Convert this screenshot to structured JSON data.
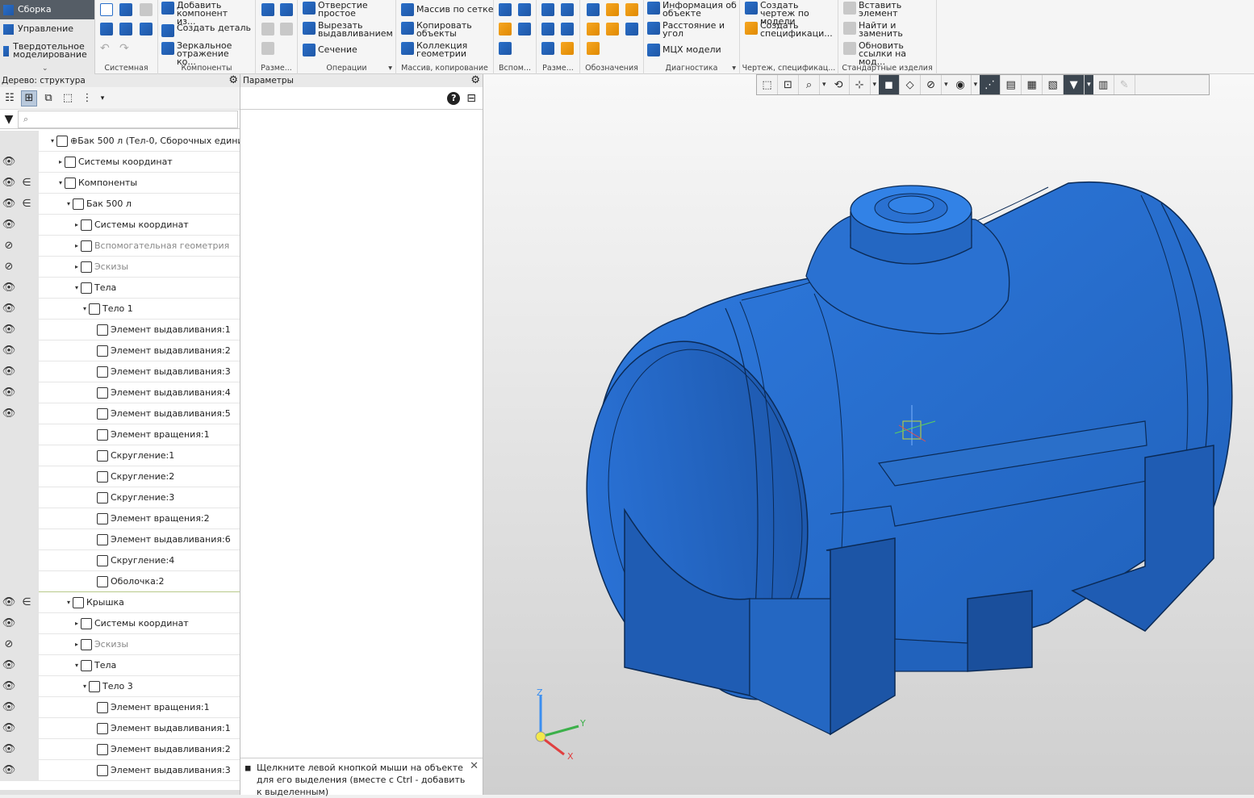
{
  "modes": {
    "items": [
      {
        "label": "Сборка",
        "active": true
      },
      {
        "label": "Управление"
      },
      {
        "label": "Твердотельное моделирование"
      }
    ]
  },
  "ribbon": {
    "groups": {
      "system": "Системная",
      "components": "Компоненты",
      "dims_short": "Разме...",
      "operations": "Операции",
      "array": "Массив, копирование",
      "aux": "Вспом...",
      "dims2": "Разме...",
      "designations": "Обозначения",
      "diagnostics": "Диагностика",
      "drawing": "Чертеж, спецификац...",
      "standard": "Стандартные изделия"
    },
    "buttons": {
      "add_component": "Добавить компонент из...",
      "create_part": "Создать деталь",
      "mirror": "Зеркальное отражение ко...",
      "hole": "Отверстие простое",
      "cut_extrude": "Вырезать выдавливанием",
      "section": "Сечение",
      "grid_array": "Массив по сетке",
      "copy_objects": "Копировать объекты",
      "geometry_collection": "Коллекция геометрии",
      "object_info": "Информация об объекте",
      "distance_angle": "Расстояние и угол",
      "mass_props": "МЦХ модели",
      "create_drawing": "Создать чертеж по модели",
      "create_spec": "Создать спецификаци...",
      "insert_element": "Вставить элемент",
      "find_replace": "Найти и заменить",
      "update_links": "Обновить ссылки на мод..."
    }
  },
  "tree_panel": {
    "title": "Дерево: структура",
    "filter_placeholder": "⌕",
    "rows": [
      {
        "label": "⊕Бак 500 л (Тел-0, Сборочных едини",
        "depth": 0,
        "toggle": "▾",
        "eye": "",
        "inc": ""
      },
      {
        "label": "Системы координат",
        "depth": 1,
        "toggle": "▸",
        "eye": "👁",
        "inc": ""
      },
      {
        "label": "Компоненты",
        "depth": 1,
        "toggle": "▾",
        "eye": "👁",
        "inc": "∈"
      },
      {
        "label": "Бак 500 л",
        "depth": 2,
        "toggle": "▾",
        "eye": "👁",
        "inc": "∈"
      },
      {
        "label": "Системы координат",
        "depth": 3,
        "toggle": "▸",
        "eye": "👁",
        "inc": ""
      },
      {
        "label": "Вспомогательная геометрия",
        "depth": 3,
        "toggle": "▸",
        "eye": "⊘",
        "inc": "",
        "dim": true
      },
      {
        "label": "Эскизы",
        "depth": 3,
        "toggle": "▸",
        "eye": "⊘",
        "inc": "",
        "dim": true
      },
      {
        "label": "Тела",
        "depth": 3,
        "toggle": "▾",
        "eye": "👁",
        "inc": ""
      },
      {
        "label": "Тело 1",
        "depth": 4,
        "toggle": "▾",
        "eye": "👁",
        "inc": ""
      },
      {
        "label": "Элемент выдавливания:1",
        "depth": 5,
        "toggle": "",
        "eye": "👁",
        "inc": ""
      },
      {
        "label": "Элемент выдавливания:2",
        "depth": 5,
        "toggle": "",
        "eye": "👁",
        "inc": ""
      },
      {
        "label": "Элемент выдавливания:3",
        "depth": 5,
        "toggle": "",
        "eye": "👁",
        "inc": ""
      },
      {
        "label": "Элемент выдавливания:4",
        "depth": 5,
        "toggle": "",
        "eye": "👁",
        "inc": ""
      },
      {
        "label": "Элемент выдавливания:5",
        "depth": 5,
        "toggle": "",
        "eye": "👁",
        "inc": ""
      },
      {
        "label": "Элемент вращения:1",
        "depth": 5,
        "toggle": "",
        "eye": "",
        "inc": ""
      },
      {
        "label": "Скругление:1",
        "depth": 5,
        "toggle": "",
        "eye": "",
        "inc": ""
      },
      {
        "label": "Скругление:2",
        "depth": 5,
        "toggle": "",
        "eye": "",
        "inc": ""
      },
      {
        "label": "Скругление:3",
        "depth": 5,
        "toggle": "",
        "eye": "",
        "inc": ""
      },
      {
        "label": "Элемент вращения:2",
        "depth": 5,
        "toggle": "",
        "eye": "",
        "inc": ""
      },
      {
        "label": "Элемент выдавливания:6",
        "depth": 5,
        "toggle": "",
        "eye": "",
        "inc": ""
      },
      {
        "label": "Скругление:4",
        "depth": 5,
        "toggle": "",
        "eye": "",
        "inc": ""
      },
      {
        "label": "Оболочка:2",
        "depth": 5,
        "toggle": "",
        "eye": "",
        "inc": ""
      },
      {
        "label": "Крышка",
        "depth": 2,
        "toggle": "▾",
        "eye": "👁",
        "inc": "∈"
      },
      {
        "label": "Системы координат",
        "depth": 3,
        "toggle": "▸",
        "eye": "👁",
        "inc": ""
      },
      {
        "label": "Эскизы",
        "depth": 3,
        "toggle": "▸",
        "eye": "⊘",
        "inc": "",
        "dim": true
      },
      {
        "label": "Тела",
        "depth": 3,
        "toggle": "▾",
        "eye": "👁",
        "inc": ""
      },
      {
        "label": "Тело 3",
        "depth": 4,
        "toggle": "▾",
        "eye": "👁",
        "inc": ""
      },
      {
        "label": "Элемент вращения:1",
        "depth": 5,
        "toggle": "",
        "eye": "👁",
        "inc": ""
      },
      {
        "label": "Элемент выдавливания:1",
        "depth": 5,
        "toggle": "",
        "eye": "👁",
        "inc": ""
      },
      {
        "label": "Элемент выдавливания:2",
        "depth": 5,
        "toggle": "",
        "eye": "👁",
        "inc": ""
      },
      {
        "label": "Элемент выдавливания:3",
        "depth": 5,
        "toggle": "",
        "eye": "👁",
        "inc": ""
      }
    ]
  },
  "params_panel": {
    "title": "Параметры",
    "help": "?",
    "hint": "Щелкните левой кнопкой мыши на объекте для его выделения (вместе с Ctrl - добавить к выделенным)"
  },
  "viewport": {
    "axes": {
      "x": "X",
      "y": "Y",
      "z": "Z"
    },
    "model_color": "#2a6fc9"
  }
}
